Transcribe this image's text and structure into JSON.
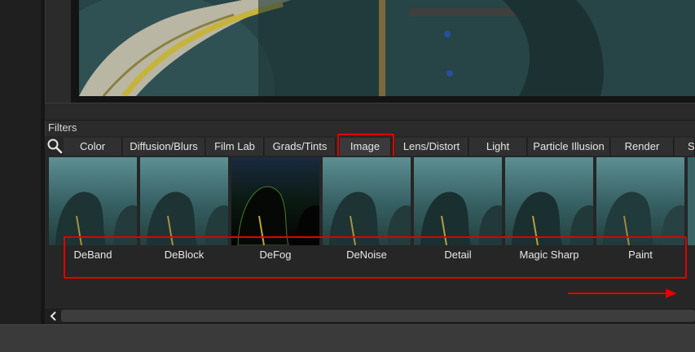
{
  "filters_panel": {
    "title": "Filters",
    "tabs": [
      {
        "label": "Color"
      },
      {
        "label": "Diffusion/Blurs"
      },
      {
        "label": "Film Lab"
      },
      {
        "label": "Grads/Tints"
      },
      {
        "label": "Image"
      },
      {
        "label": "Lens/Distort"
      },
      {
        "label": "Light"
      },
      {
        "label": "Particle Illusion"
      },
      {
        "label": "Render"
      },
      {
        "label": "St"
      }
    ],
    "selected_tab": "Image",
    "thumbnails": [
      {
        "label": "DeBand"
      },
      {
        "label": "DeBlock"
      },
      {
        "label": "DeFog"
      },
      {
        "label": "DeNoise"
      },
      {
        "label": "Detail"
      },
      {
        "label": "Magic Sharp"
      },
      {
        "label": "Paint"
      }
    ]
  },
  "colors": {
    "annotation_red": "#e00000",
    "panel_bg": "#262626",
    "teal_photo": "#2b4a4c"
  },
  "icons": [
    "search-icon",
    "chevron-left-icon",
    "arrow-right-icon"
  ]
}
